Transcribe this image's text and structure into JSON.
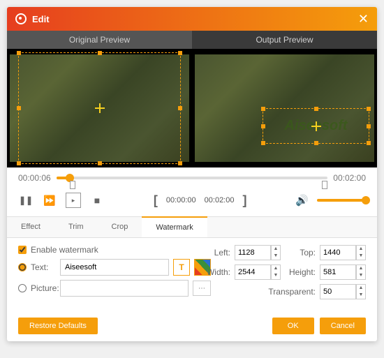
{
  "title": "Edit",
  "preview": {
    "original_label": "Original Preview",
    "output_label": "Output Preview"
  },
  "timeline": {
    "current": "00:00:06",
    "total": "00:02:00"
  },
  "range": {
    "start": "00:00:00",
    "end": "00:02:00"
  },
  "tabs": {
    "effect": "Effect",
    "trim": "Trim",
    "crop": "Crop",
    "watermark": "Watermark"
  },
  "watermark": {
    "enable_label": "Enable watermark",
    "text_label": "Text:",
    "text_value": "Aiseesoft",
    "picture_label": "Picture:",
    "picture_value": "",
    "display_text": "Aiseesoft"
  },
  "position": {
    "left_label": "Left:",
    "left_value": "1128",
    "top_label": "Top:",
    "top_value": "1440",
    "width_label": "Width:",
    "width_value": "2544",
    "height_label": "Height:",
    "height_value": "581",
    "transparent_label": "Transparent:",
    "transparent_value": "50"
  },
  "buttons": {
    "restore": "Restore Defaults",
    "ok": "OK",
    "cancel": "Cancel"
  }
}
